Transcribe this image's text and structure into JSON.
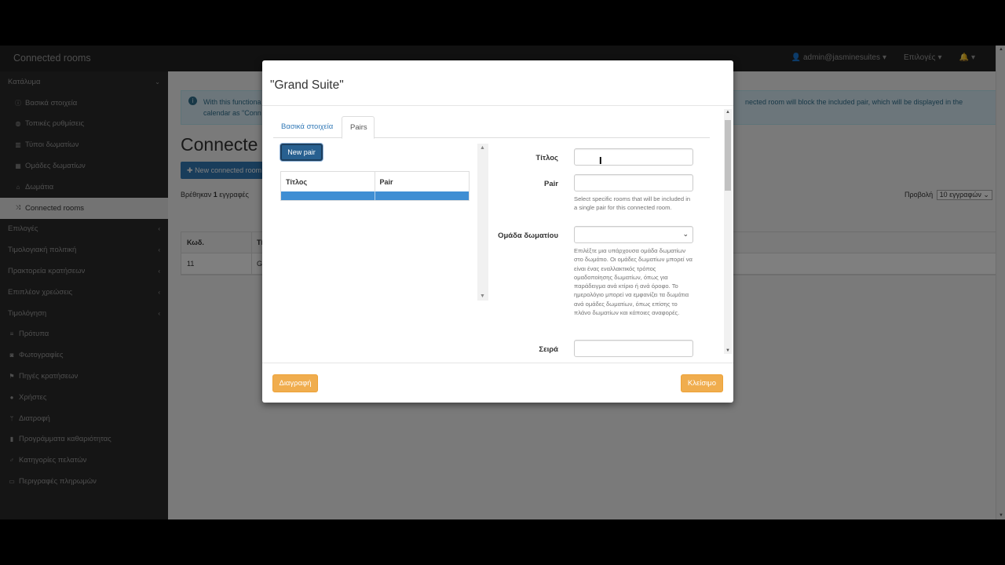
{
  "navbar": {
    "brand": "Connected rooms",
    "user": "admin@jasminesuites",
    "options": "Επιλογές",
    "bell_caret": "▾"
  },
  "sidebar": {
    "items": [
      {
        "label": "Κατάλυμα",
        "icon": "",
        "sub": false,
        "chevron": "⌄",
        "active": false
      },
      {
        "label": "Βασικά στοιχεία",
        "icon": "info-circle-icon",
        "sub": true,
        "active": false
      },
      {
        "label": "Τοπικές ρυθμίσεις",
        "icon": "globe-icon",
        "sub": true,
        "active": false
      },
      {
        "label": "Τύποι δωματίων",
        "icon": "building-icon",
        "sub": true,
        "active": false
      },
      {
        "label": "Ομάδες δωματίων",
        "icon": "grid-icon",
        "sub": true,
        "active": false
      },
      {
        "label": "Δωμάτια",
        "icon": "home-icon",
        "sub": true,
        "active": false
      },
      {
        "label": "Connected rooms",
        "icon": "random-icon",
        "sub": true,
        "active": true
      },
      {
        "label": "Επιλογές",
        "icon": "",
        "sub": false,
        "chevron": "‹",
        "active": false
      },
      {
        "label": "Τιμολογιακή πολιτική",
        "icon": "",
        "sub": false,
        "chevron": "‹",
        "active": false
      },
      {
        "label": "Πρακτορεία κρατήσεων",
        "icon": "",
        "sub": false,
        "chevron": "‹",
        "active": false
      },
      {
        "label": "Επιπλέον χρεώσεις",
        "icon": "",
        "sub": false,
        "chevron": "‹",
        "active": false
      },
      {
        "label": "Τιμολόγηση",
        "icon": "",
        "sub": false,
        "chevron": "‹",
        "active": false
      },
      {
        "label": "Πρότυπα",
        "icon": "list-icon",
        "sub": false,
        "active": false
      },
      {
        "label": "Φωτογραφίες",
        "icon": "camera-icon",
        "sub": false,
        "active": false
      },
      {
        "label": "Πηγές κρατήσεων",
        "icon": "map-marker-icon",
        "sub": false,
        "active": false
      },
      {
        "label": "Χρήστες",
        "icon": "user-icon",
        "sub": false,
        "active": false
      },
      {
        "label": "Διατροφή",
        "icon": "cutlery-icon",
        "sub": false,
        "active": false
      },
      {
        "label": "Προγράμματα καθαριότητας",
        "icon": "trash-icon",
        "sub": false,
        "active": false
      },
      {
        "label": "Κατηγορίες πελατών",
        "icon": "male-icon",
        "sub": false,
        "active": false
      },
      {
        "label": "Περιγραφές πληρωμών",
        "icon": "credit-card-icon",
        "sub": false,
        "active": false
      }
    ]
  },
  "main": {
    "alert_left": "With this functiona",
    "alert_left2": "calendar as \"Conn",
    "alert_right": "nected room will block the included pair, which will be displayed in the",
    "page_title": "Connecte",
    "new_button": "New connected room",
    "found_prefix": "Βρέθηκαν ",
    "found_count": "1",
    "found_suffix": " εγγραφές",
    "view_label": "Προβολή",
    "view_value": "10 εγγραφών",
    "table_headers": [
      "Κωδ.",
      "Τίτ"
    ],
    "table_rows": [
      [
        "11",
        "Gr"
      ]
    ]
  },
  "modal": {
    "title": "\"Grand Suite\"",
    "tabs": [
      "Βασικά στοιχεία",
      "Pairs"
    ],
    "active_tab": "Pairs",
    "new_pair_label": "New pair",
    "pairs_headers": [
      "Τίτλος",
      "Pair"
    ],
    "form": {
      "title_label": "Τίτλος",
      "title_value": "",
      "pair_label": "Pair",
      "pair_value": "",
      "pair_help": "Select specific rooms that will be included in a single pair for this connected room.",
      "group_label": "Ομάδα δωματίου",
      "group_value": "",
      "group_help": "Επιλέξτε μια υπάρχουσα ομάδα δωματίων στο δωμάτιο. Οι ομάδες δωματίων μπορεί να είναι ένας εναλλακτικός τρόπος ομαδοποίησης δωματίων, όπως για παράδειγμα ανά κτίριο ή ανά όροφο. Το ημερολόγιο μπορεί να εμφανίζει τα δωμάτια ανά ομάδες δωματίων, όπως επίσης το πλάνο δωματίων και κάποιες αναφορές.",
      "order_label": "Σειρά",
      "order_value": ""
    },
    "delete_label": "Διαγραφή",
    "close_label": "Κλείσιμο"
  },
  "colors": {
    "primary": "#337ab7",
    "warning": "#f0ad4e",
    "navbar": "#222222",
    "sidebar": "#2b2b2b",
    "selected_row": "#3f8ed3"
  }
}
